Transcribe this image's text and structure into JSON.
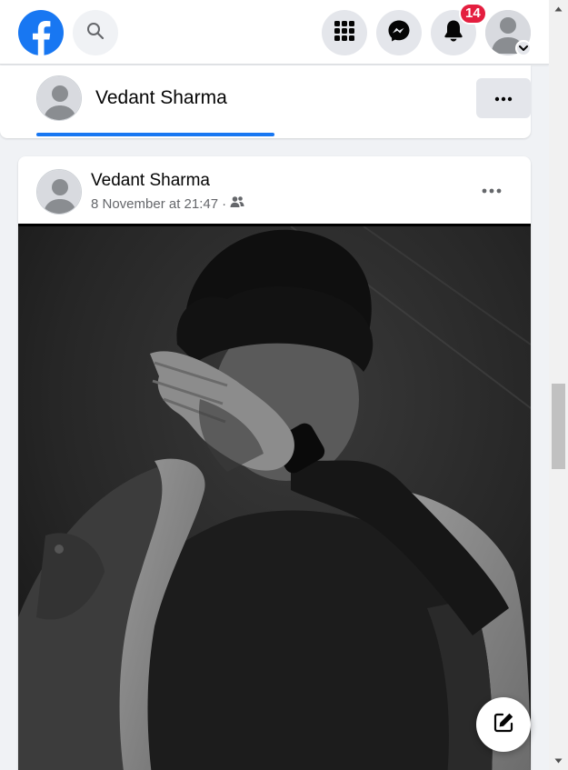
{
  "topbar": {
    "logo": "facebook-logo",
    "search_icon": "search-icon",
    "menu_icon": "grid-menu-icon",
    "messenger_icon": "messenger-icon",
    "notifications_icon": "bell-icon",
    "notifications_count": "14",
    "account_icon": "avatar-placeholder",
    "account_caret_icon": "chevron-down-icon"
  },
  "profile_header": {
    "name": "Vedant Sharma",
    "more_icon": "more-horizontal-icon"
  },
  "post": {
    "author": "Vedant Sharma",
    "date": "8 November at 21:47",
    "separator": "·",
    "audience_icon": "friends-icon",
    "more_icon": "more-horizontal-icon",
    "photo_description_icon": "photo"
  },
  "fab": {
    "icon": "compose-icon"
  },
  "colors": {
    "brand": "#1877f2",
    "badge": "#e41e3f",
    "page_bg": "#f0f2f5",
    "button_bg": "#e4e6eb",
    "secondary_text": "#65676b"
  }
}
